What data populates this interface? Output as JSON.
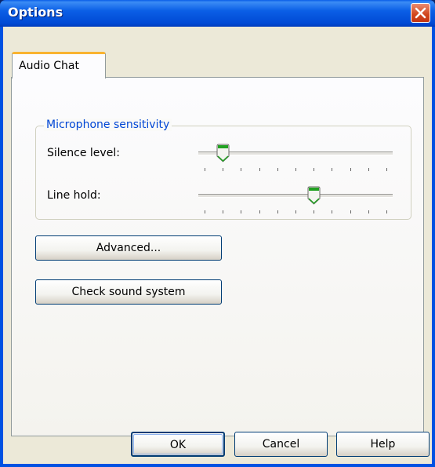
{
  "window": {
    "title": "Options",
    "close_icon": "close-icon"
  },
  "tabs": [
    {
      "label": "Audio Chat",
      "selected": true
    }
  ],
  "microphone_group": {
    "label": "Microphone sensitivity",
    "silence_level": {
      "label": "Silence level:",
      "value_fraction": 0.1,
      "tick_count": 11
    },
    "line_hold": {
      "label": "Line hold:",
      "value_fraction": 0.6,
      "tick_count": 11
    }
  },
  "buttons": {
    "advanced": "Advanced...",
    "check_sound": "Check sound system",
    "ok": "OK",
    "cancel": "Cancel",
    "help": "Help"
  },
  "colors": {
    "titlebar": "#0055e5",
    "group_label": "#0046d5",
    "tab_highlight": "#f9b330",
    "slider_thumb_accent": "#21a121"
  }
}
